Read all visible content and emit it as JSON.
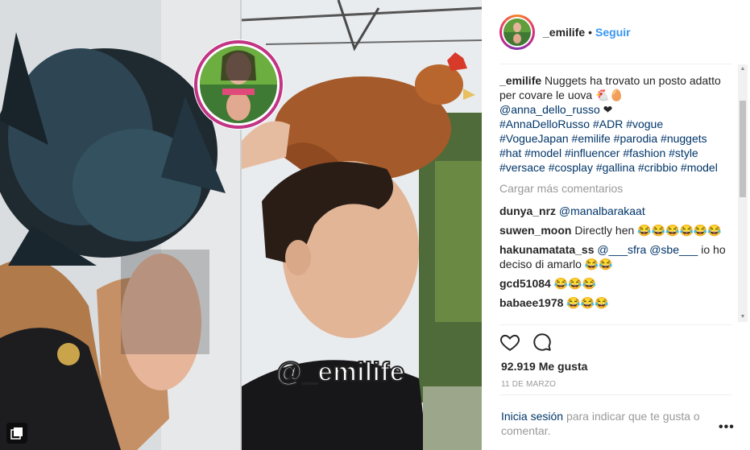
{
  "post": {
    "watermark": "@_emilife",
    "multi_icon": "multiple-photos-icon"
  },
  "header": {
    "username": "_emilife",
    "dot": "•",
    "follow_label": "Seguir"
  },
  "caption": {
    "username": "_emilife",
    "text": "Nuggets ha trovato un posto adatto per covare le uova 🐔🥚",
    "mention": "@anna_dello_russo",
    "heart": "❤",
    "hashtags": "#AnnaDelloRusso #ADR #vogue #VogueJapan #emilife #parodia #nuggets #hat #model #influencer #fashion #style #versace #cosplay #gallina #cribbio #model"
  },
  "load_more": "Cargar más comentarios",
  "comments": [
    {
      "user": "dunya_nrz",
      "mention": "@manalbarakaat",
      "text": ""
    },
    {
      "user": "suwen_moon",
      "mention": "",
      "text": "Directly hen 😂😂😂😂😂😂"
    },
    {
      "user": "hakunamatata_ss",
      "mention": "@___sfra @sbe___",
      "text": "io ho deciso di amarlo 😂😂"
    },
    {
      "user": "gcd51084",
      "mention": "",
      "text": "😂😂😂"
    },
    {
      "user": "babaee1978",
      "mention": "",
      "text": "😂😂😂"
    }
  ],
  "actions": {
    "like_icon": "heart-icon",
    "comment_icon": "comment-icon"
  },
  "likes": "92.919 Me gusta",
  "date": "11 DE MARZO",
  "login": {
    "link": "Inicia sesión",
    "text": "para indicar que te gusta o comentar."
  },
  "more_options": "•••"
}
